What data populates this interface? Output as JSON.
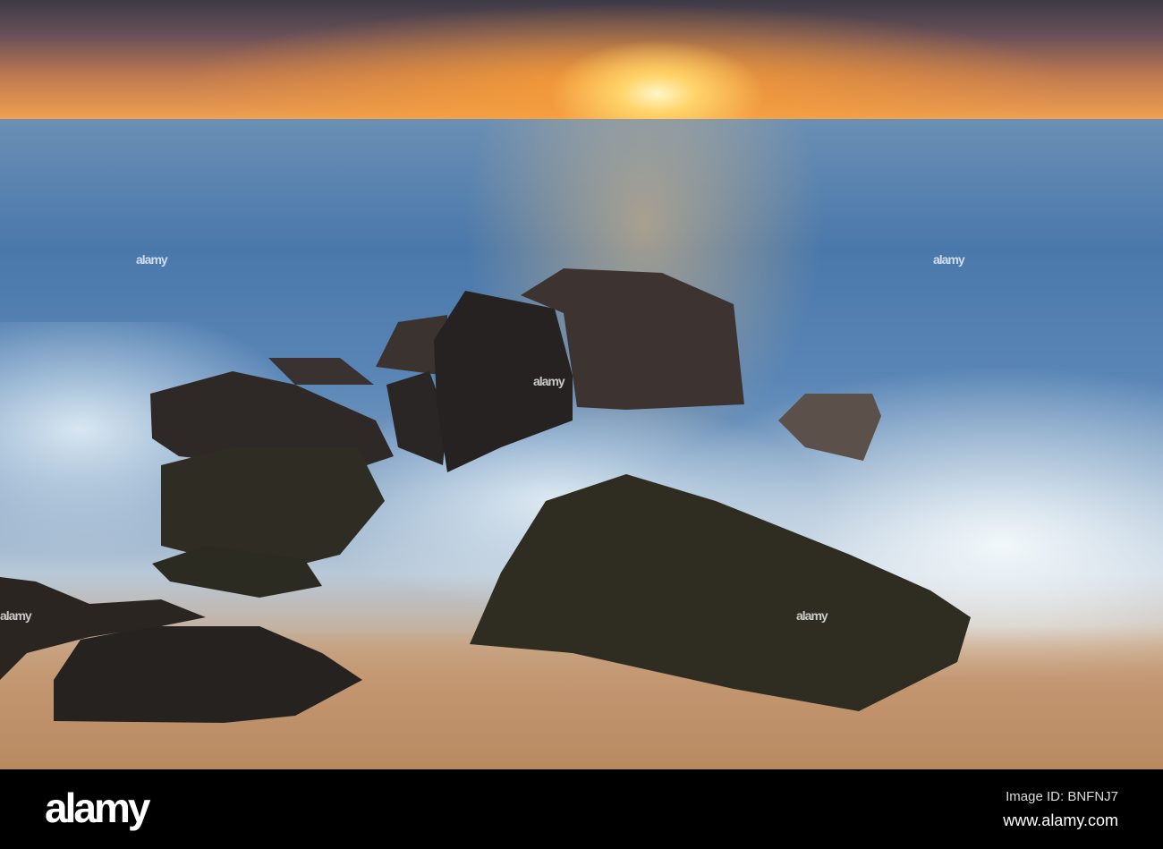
{
  "photo": {
    "subject": "Waves crashing on rocks at sunset",
    "watermark": "alamy"
  },
  "footer": {
    "logo": "alamy",
    "image_id": "Image ID: BNFNJ7",
    "website": "www.alamy.com"
  }
}
